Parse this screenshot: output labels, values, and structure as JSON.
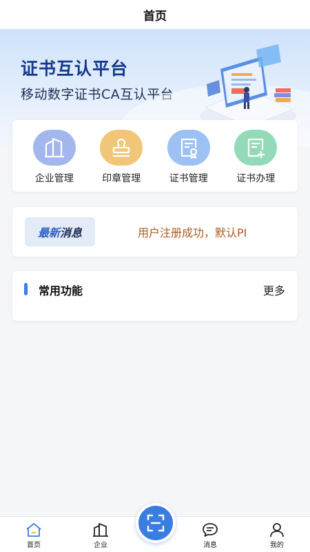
{
  "header": {
    "title": "首页"
  },
  "banner": {
    "title": "证书互认平台",
    "subtitle": "移动数字证书CA互认平台"
  },
  "entries": [
    {
      "label": "企业管理",
      "icon": "building-icon",
      "color": "#9fb3ec"
    },
    {
      "label": "印章管理",
      "icon": "stamp-icon",
      "color": "#f0c67a"
    },
    {
      "label": "证书管理",
      "icon": "certificate-icon",
      "color": "#9cc0f2"
    },
    {
      "label": "证书办理",
      "icon": "document-add-icon",
      "color": "#8fd9b6"
    }
  ],
  "news": {
    "tag_part1": "最新",
    "tag_part2": "消息",
    "text": "用户注册成功，默认PI"
  },
  "common": {
    "title": "常用功能",
    "more": "更多"
  },
  "tabbar": {
    "items": [
      {
        "label": "首页",
        "icon": "home-icon",
        "active": true
      },
      {
        "label": "企业",
        "icon": "building-icon",
        "active": false
      },
      {
        "label": "",
        "icon": "scan-icon",
        "active": false
      },
      {
        "label": "消息",
        "icon": "message-icon",
        "active": false
      },
      {
        "label": "我的",
        "icon": "user-icon",
        "active": false
      }
    ]
  },
  "colors": {
    "accent": "#3a7de0",
    "news_text": "#b05a1e",
    "banner_title": "#153a8a"
  }
}
